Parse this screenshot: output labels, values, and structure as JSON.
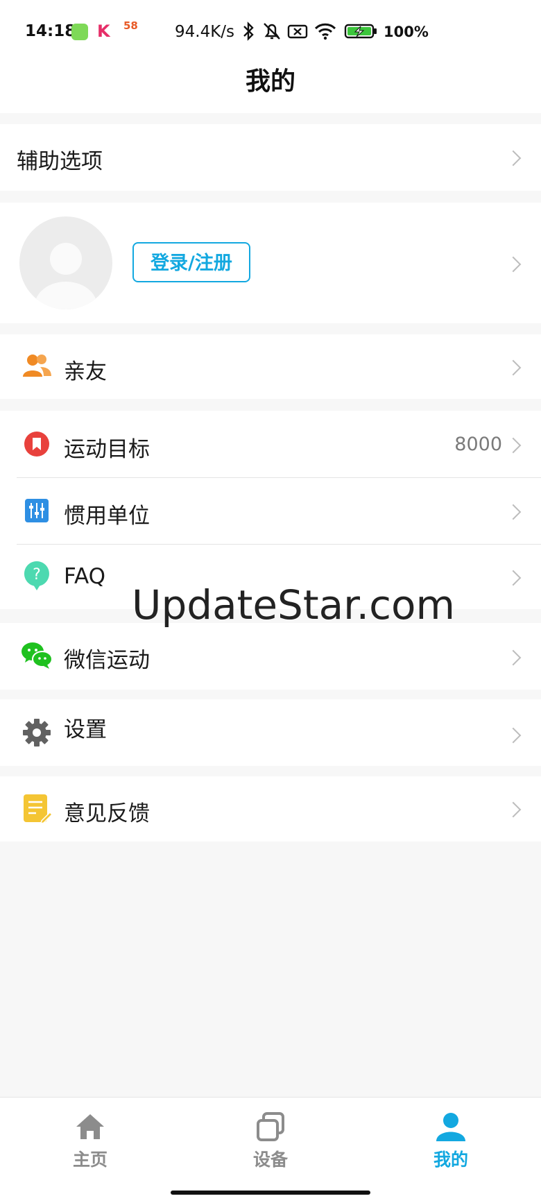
{
  "status_bar": {
    "time": "14:18",
    "app_icons": [
      "lobster-app-icon",
      "k-app-icon",
      "58-app-icon"
    ],
    "k_app_glyph": "K",
    "app58_glyph": "58",
    "net_speed": "94.4K/s",
    "battery_text": "100%"
  },
  "header": {
    "title": "我的"
  },
  "assist": {
    "label": "辅助选项"
  },
  "profile": {
    "login_label": "登录/注册"
  },
  "menu": {
    "friends": "亲友",
    "goal": "运动目标",
    "goal_value": "8000",
    "units": "惯用单位",
    "faq": "FAQ",
    "wechat": "微信运动",
    "settings": "设置",
    "feedback": "意见反馈"
  },
  "watermark": "UpdateStar.com",
  "tabs": [
    {
      "label": "主页",
      "icon": "home-icon",
      "active": false
    },
    {
      "label": "设备",
      "icon": "device-icon",
      "active": false
    },
    {
      "label": "我的",
      "icon": "profile-icon",
      "active": true
    }
  ],
  "colors": {
    "accent": "#13a8e0",
    "inactive_tab": "#8c8c8c",
    "friends_icon": "#f08a24",
    "goal_icon": "#e8413c",
    "units_icon": "#2e8fe3",
    "faq_icon": "#4dd9b0",
    "wechat_icon": "#1fc11f",
    "settings_icon": "#616161",
    "feedback_icon": "#f4c534"
  }
}
